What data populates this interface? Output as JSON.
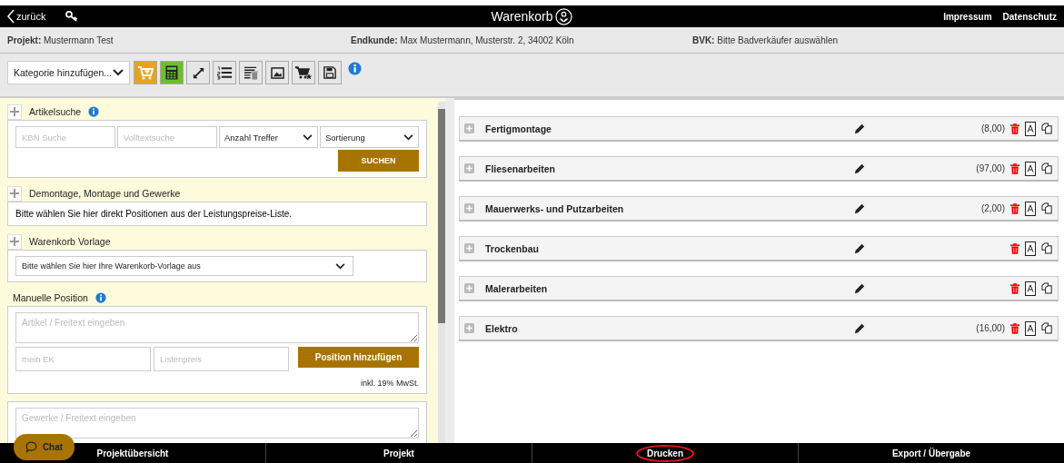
{
  "header": {
    "back": "zurück",
    "title": "Warenkorb",
    "links": [
      "Impressum",
      "Datenschutz"
    ]
  },
  "info": [
    {
      "label": "Projekt:",
      "value": "Mustermann Test"
    },
    {
      "label": "Endkunde:",
      "value": "Max Mustermann, Musterstr. 2, 34002 Köln"
    },
    {
      "label": "BVK:",
      "value": "Bitte Badverkäufer auswählen"
    }
  ],
  "toolbar": {
    "category_select": "Kategorie hinzufügen...",
    "buttons": [
      {
        "kind": "cart-plus",
        "color": "#e3a323"
      },
      {
        "kind": "calculator",
        "color": "#6cbf2a"
      },
      {
        "kind": "expand",
        "color": "#e6e6e6"
      },
      {
        "kind": "numbered-list",
        "color": "#e6e6e6"
      },
      {
        "kind": "list-trash",
        "color": "#e6e6e6"
      },
      {
        "kind": "image",
        "color": "#e6e6e6"
      },
      {
        "kind": "cart-star",
        "color": "#e6e6e6"
      },
      {
        "kind": "save",
        "color": "#e6e6e6"
      }
    ]
  },
  "article_search": {
    "title": "Artikelsuche",
    "fields": [
      {
        "placeholder": "KBN Suche"
      },
      {
        "placeholder": "Volltextsuche"
      }
    ],
    "selects": [
      "Anzahl Treffer",
      "Sortierung"
    ],
    "button": "SUCHEN"
  },
  "services": {
    "title": "Demontage, Montage und Gewerke",
    "text": "Bitte wählen Sie hier direkt Positionen aus der Leistungspreise-Liste."
  },
  "template": {
    "title": "Warenkorb Vorlage",
    "select": "Bitte wählen Sie hier Ihre Warenkorb-Vorlage aus"
  },
  "manual_position": {
    "title": "Manuelle Position",
    "article_placeholder": "Artikel / Freitext eingeben",
    "ek_placeholder": "mein EK",
    "list_price_placeholder": "Listenpreis",
    "button": "Position hinzufügen",
    "note": "inkl. 19% MwSt.",
    "trade_placeholder": "Gewerke / Freitext eingeben"
  },
  "categories": [
    {
      "name": "Fertigmontage",
      "amount": "(8,00)"
    },
    {
      "name": "Fliesenarbeiten",
      "amount": "(97,00)"
    },
    {
      "name": "Mauerwerks- und Putzarbeiten",
      "amount": "(2,00)"
    },
    {
      "name": "Trockenbau"
    },
    {
      "name": "Malerarbeiten"
    },
    {
      "name": "Elektro",
      "amount": "(16,00)"
    }
  ],
  "bottom_nav": [
    {
      "label": "Projektübersicht",
      "circled": false
    },
    {
      "label": "Projekt",
      "circled": false
    },
    {
      "label": "Drucken",
      "circled": true
    },
    {
      "label": "Export / Übergabe",
      "circled": false
    }
  ],
  "chat": {
    "label": "Chat"
  }
}
